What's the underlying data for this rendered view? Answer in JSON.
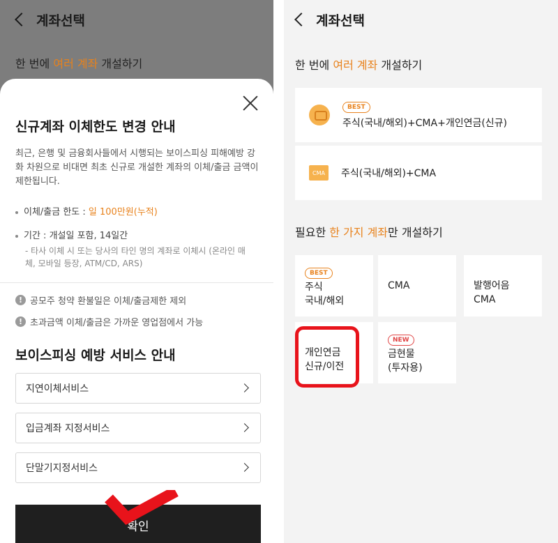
{
  "left": {
    "header": {
      "title": "계좌선택"
    },
    "intro": {
      "pre": "한 번에 ",
      "accent": "여러 계좌",
      "post": " 개설하기"
    },
    "sheet": {
      "title": "신규계좌 이체한도 변경 안내",
      "description": "최근, 은행 및 금융회사들에서 시행되는 보이스피싱 피해예방 강화 차원으로 비대면 최초 신규로 개설한 계좌의 이체/출금 금액이 제한됩니다.",
      "limit_label": "이체/출금 한도 : ",
      "limit_value": "일 100만원(누적)",
      "period": "기간 : 개설일 포함, 14일간",
      "period_note": "- 타사 이체 시 또는 당사의 타인 명의 계좌로 이체시 (온라인 매체, 모바일 등장, ATM/CD, ARS)",
      "warnings": [
        "공모주 청약 환불일은 이체/출금제한 제외",
        "초과금액 이체/출금은 가까운 영업점에서 가능"
      ],
      "section_title": "보이스피싱 예방 서비스 안내",
      "services": [
        "지연이체서비스",
        "입금계좌 지정서비스",
        "단말기지정서비스"
      ],
      "confirm_label": "확인"
    }
  },
  "right": {
    "header": {
      "title": "계좌선택"
    },
    "intro": {
      "pre": "한 번에 ",
      "accent": "여러 계좌",
      "post": " 개설하기"
    },
    "bundles": [
      {
        "badge": "BEST",
        "label": "주식(국내/해외)+CMA+개인연금(신규)",
        "icon": "coin-icon"
      },
      {
        "label": "주식(국내/해외)+CMA",
        "icon": "cma-icon",
        "icon_text": "CMA"
      }
    ],
    "single_title": {
      "pre": "필요한 ",
      "accent": "한 가지 계좌",
      "post": "만 개설하기"
    },
    "tiles": [
      {
        "badge": "BEST",
        "line1": "주식",
        "line2": "국내/해외"
      },
      {
        "line1": "CMA",
        "line2": ""
      },
      {
        "line1": "발행어음",
        "line2": "CMA"
      },
      {
        "line1": "개인연금",
        "line2": "신규/이전"
      },
      {
        "badge": "NEW",
        "line1": "금현물",
        "line2": "(투자용)"
      }
    ]
  },
  "colors": {
    "accent": "#e8821c",
    "highlight": "#e8131b",
    "confirm_bg": "#1f1f1f",
    "new_badge": "#e04545"
  }
}
